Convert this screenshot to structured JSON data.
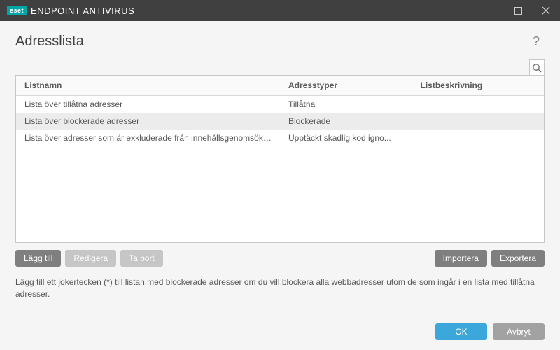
{
  "titlebar": {
    "brand": "eset",
    "app_name": "ENDPOINT ANTIVIRUS"
  },
  "page": {
    "title": "Adresslista",
    "help_glyph": "?"
  },
  "table": {
    "headers": {
      "name": "Listnamn",
      "type": "Adresstyper",
      "desc": "Listbeskrivning"
    },
    "rows": [
      {
        "name": "Lista över tillåtna adresser",
        "type": "Tillåtna",
        "desc": "",
        "selected": false
      },
      {
        "name": "Lista över blockerade adresser",
        "type": "Blockerade",
        "desc": "",
        "selected": true
      },
      {
        "name": "Lista över adresser som är exkluderade från innehållsgenomsökning",
        "type": "Upptäckt skadlig kod igno...",
        "desc": "",
        "selected": false
      }
    ]
  },
  "actions": {
    "add": "Lägg till",
    "edit": "Redigera",
    "delete": "Ta bort",
    "import": "Importera",
    "export": "Exportera"
  },
  "hint": "Lägg till ett jokertecken (*) till listan med blockerade adresser om du vill blockera alla webbadresser utom de som ingår i en lista med tillåtna adresser.",
  "footer": {
    "ok": "OK",
    "cancel": "Avbryt"
  }
}
